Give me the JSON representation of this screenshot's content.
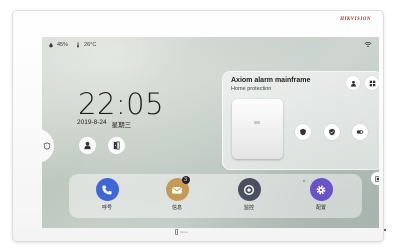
{
  "device": {
    "brand": "HIKVISION",
    "home_button_label": "home"
  },
  "status": {
    "humidity": "45%",
    "temperature": "26°C",
    "icons": [
      "humidity-drop-icon",
      "thermometer-icon",
      "wifi-icon"
    ]
  },
  "clock": {
    "time": "22:05",
    "date": "2019-8-24",
    "weekday": "星期三"
  },
  "quick_actions": {
    "left": "shield-user-icon",
    "right": "door-icon"
  },
  "alarm": {
    "title": "Axiom alarm mainframe",
    "subtitle": "Home protection",
    "page_count": 4,
    "active_page": 1
  },
  "dock": {
    "items": [
      {
        "label": "呼号",
        "icon": "phone-icon",
        "color": "#3f66d8"
      },
      {
        "label": "信息",
        "icon": "envelope-icon",
        "color": "#c59a55",
        "badge": "3"
      },
      {
        "label": "监控",
        "icon": "camera-icon",
        "color": "#4a5060"
      },
      {
        "label": "配置",
        "icon": "gear-icon",
        "color": "#6a52c8"
      }
    ]
  },
  "colors": {
    "brand": "#bb2222",
    "screen": "#c4cec4"
  }
}
